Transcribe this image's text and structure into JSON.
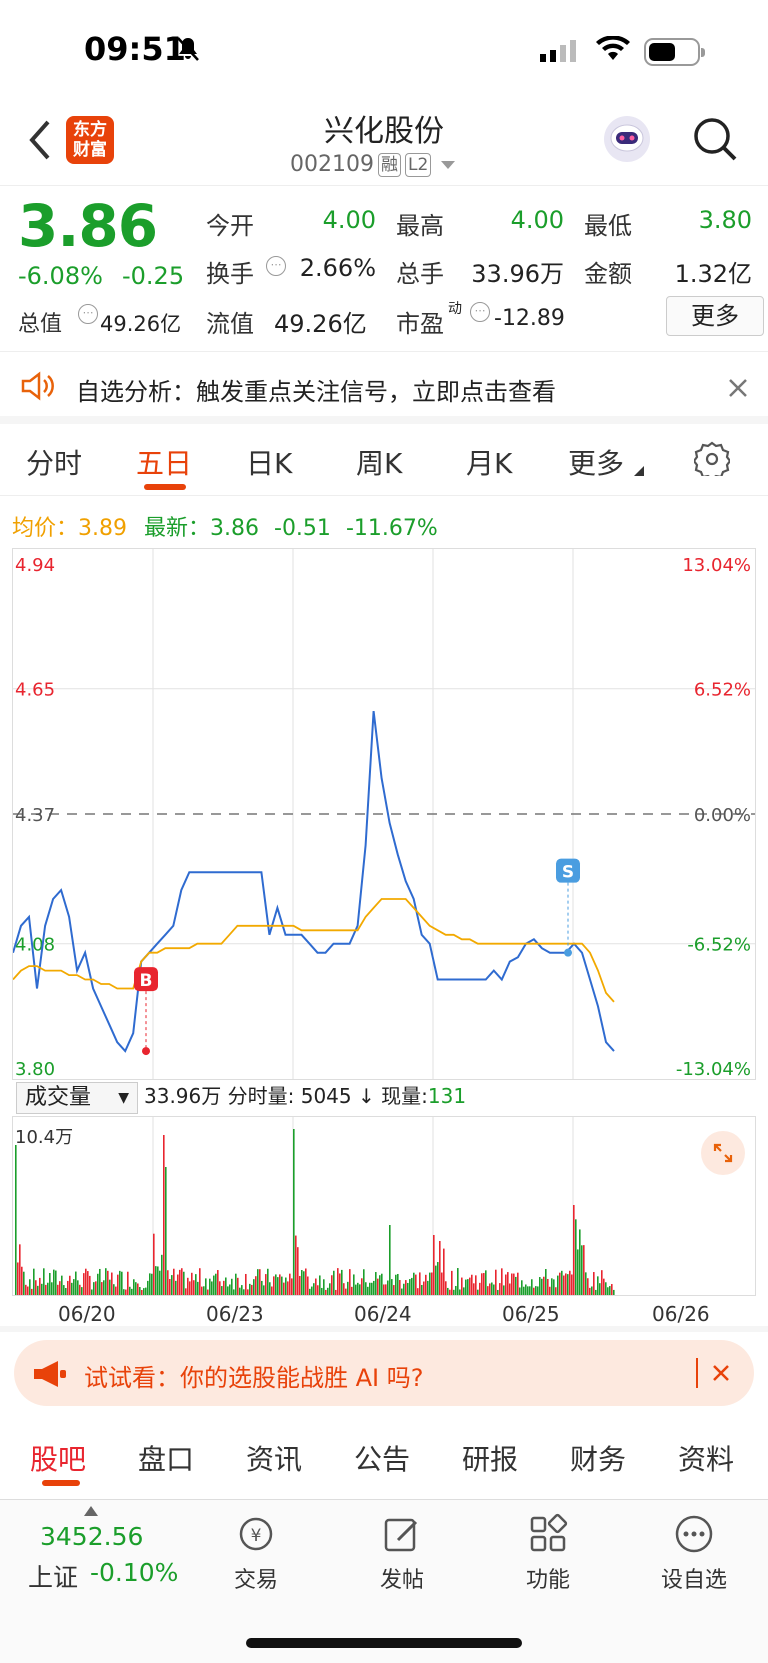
{
  "status": {
    "time": "09:51"
  },
  "header": {
    "logo_line1": "东方",
    "logo_line2": "财富",
    "stock_name": "兴化股份",
    "stock_code": "002109",
    "tag_rong": "融",
    "tag_l2": "L2"
  },
  "quote": {
    "price": "3.86",
    "change_pct": "-6.08%",
    "change_amt": "-0.25",
    "fields": [
      {
        "label": "今开",
        "value": "4.00",
        "color": "green"
      },
      {
        "label": "最高",
        "value": "4.00",
        "color": "green"
      },
      {
        "label": "最低",
        "value": "3.80",
        "color": "green"
      },
      {
        "label": "换手",
        "value": "2.66%",
        "color": "dark"
      },
      {
        "label": "总手",
        "value": "33.96万",
        "color": "dark"
      },
      {
        "label": "金额",
        "value": "1.32亿",
        "color": "dark"
      },
      {
        "label": "总值",
        "value": "49.26亿",
        "color": "dark"
      },
      {
        "label": "流值",
        "value": "49.26亿",
        "color": "dark"
      },
      {
        "label": "市盈",
        "sup": "动",
        "value": "-12.89",
        "color": "dark"
      }
    ],
    "more_label": "更多"
  },
  "notice": {
    "text": "自选分析：触发重点关注信号，立即点击查看"
  },
  "tabs": [
    "分时",
    "五日",
    "日K",
    "周K",
    "月K",
    "更多"
  ],
  "active_tab": "五日",
  "avg_line": {
    "avg_label": "均价：",
    "avg_value": "3.89",
    "latest_label": "最新：",
    "latest_value": "3.86",
    "chg": "-0.51",
    "pct": "-11.67%"
  },
  "chart_data": {
    "type": "line",
    "title": "",
    "x_labels": [
      "06/20",
      "06/23",
      "06/24",
      "06/25",
      "06/26"
    ],
    "y_ticks_left": [
      "4.94",
      "4.65",
      "4.37",
      "4.08",
      "3.80"
    ],
    "y_ticks_right": [
      "13.04%",
      "6.52%",
      "0.00%",
      "-6.52%",
      "-13.04%"
    ],
    "ylim": [
      3.8,
      4.94
    ],
    "prev_close": 4.37,
    "series": [
      {
        "name": "",
        "color": "#2f6bd0",
        "values": [
          4.06,
          4.12,
          4.14,
          3.98,
          4.12,
          4.18,
          4.2,
          4.14,
          4.02,
          4.06,
          3.98,
          3.94,
          3.9,
          3.86,
          3.84,
          3.88,
          4.04,
          4.06,
          4.08,
          4.1,
          4.12,
          4.2,
          4.24,
          4.24,
          4.24,
          4.24,
          4.24,
          4.24,
          4.24,
          4.24,
          4.24,
          4.24,
          4.1,
          4.16,
          4.1,
          4.1,
          4.1,
          4.08,
          4.06,
          4.06,
          4.08,
          4.08,
          4.08,
          4.12,
          4.3,
          4.6,
          4.45,
          4.35,
          4.28,
          4.22,
          4.18,
          4.1,
          4.08,
          4.0,
          4.0,
          4.0,
          4.0,
          4.0,
          4.0,
          4.0,
          4.02,
          4.0,
          4.04,
          4.05,
          4.08,
          4.09,
          4.07,
          4.06,
          4.06,
          4.06,
          4.08,
          4.06,
          4.0,
          3.94,
          3.86,
          3.84
        ]
      },
      {
        "name": "",
        "color": "#f2a900",
        "values": [
          4.0,
          4.02,
          4.03,
          4.03,
          4.02,
          4.02,
          4.02,
          4.01,
          4.01,
          4.0,
          4.0,
          3.99,
          3.99,
          3.98,
          3.98,
          3.98,
          4.04,
          4.06,
          4.06,
          4.07,
          4.07,
          4.07,
          4.07,
          4.08,
          4.08,
          4.08,
          4.08,
          4.1,
          4.12,
          4.12,
          4.12,
          4.12,
          4.12,
          4.12,
          4.12,
          4.12,
          4.11,
          4.11,
          4.11,
          4.11,
          4.11,
          4.11,
          4.11,
          4.11,
          4.14,
          4.16,
          4.18,
          4.18,
          4.18,
          4.18,
          4.16,
          4.14,
          4.12,
          4.11,
          4.1,
          4.1,
          4.09,
          4.09,
          4.08,
          4.08,
          4.08,
          4.08,
          4.08,
          4.08,
          4.08,
          4.08,
          4.08,
          4.08,
          4.08,
          4.08,
          4.08,
          4.08,
          4.06,
          4.02,
          3.97,
          3.95
        ]
      }
    ],
    "markers": [
      {
        "label": "B",
        "color": "#e8252f"
      },
      {
        "label": "S",
        "color": "#4a9de0"
      }
    ]
  },
  "volume": {
    "selector": "成交量",
    "total": "33.96万",
    "fen_label": "分时量:",
    "fen_value": "5045",
    "arrow": "↓",
    "now_label": "现量:",
    "now_value": "131",
    "max_label": "10.4万"
  },
  "banner": {
    "text": "试试看：你的选股能战胜 AI 吗?"
  },
  "bottom_tabs": [
    "股吧",
    "盘口",
    "资讯",
    "公告",
    "研报",
    "财务",
    "资料"
  ],
  "index": {
    "value": "3452.56",
    "name": "上证",
    "pct": "-0.10%"
  },
  "nav": [
    {
      "label": "交易",
      "icon": "trade-icon"
    },
    {
      "label": "发帖",
      "icon": "post-icon"
    },
    {
      "label": "功能",
      "icon": "grid-icon"
    },
    {
      "label": "设自选",
      "icon": "more-icon"
    }
  ]
}
